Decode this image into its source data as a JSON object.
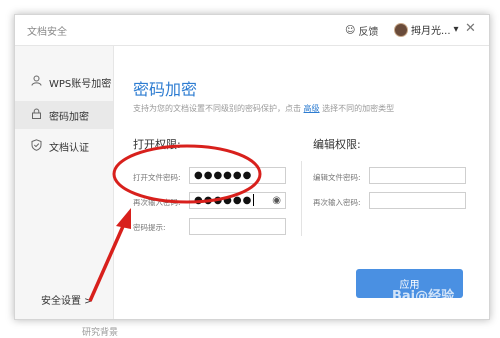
{
  "window": {
    "title": "文档安全",
    "feedback_label": "反馈",
    "user_name": "拇月光...",
    "close_glyph": "✕"
  },
  "sidebar": {
    "items": [
      {
        "icon": "user-icon",
        "label": "WPS账号加密",
        "active": false
      },
      {
        "icon": "lock-icon",
        "label": "密码加密",
        "active": true
      },
      {
        "icon": "shield-check-icon",
        "label": "文档认证",
        "active": false
      }
    ],
    "footer_label": "安全设置 >"
  },
  "main": {
    "title": "密码加密",
    "description_before": "支持为您的文档设置不同级别的密码保护，点击",
    "description_link": "高级",
    "description_after": "选择不同的加密类型",
    "open_permission": {
      "title": "打开权限:",
      "open_password_label": "打开文件密码:",
      "open_password_value": "●●●●●●",
      "confirm_password_label": "再次输入密码:",
      "confirm_password_value": "●●●●●●",
      "hint_label": "密码提示:",
      "hint_value": ""
    },
    "edit_permission": {
      "title": "编辑权限:",
      "edit_password_label": "编辑文件密码:",
      "edit_password_value": "",
      "confirm_password_label": "再次输入密码:",
      "confirm_password_value": ""
    },
    "apply_label": "应用"
  },
  "annotations": {
    "highlight_color": "#d8201c"
  },
  "caption": "研究背景",
  "watermark": "Bai@经验"
}
